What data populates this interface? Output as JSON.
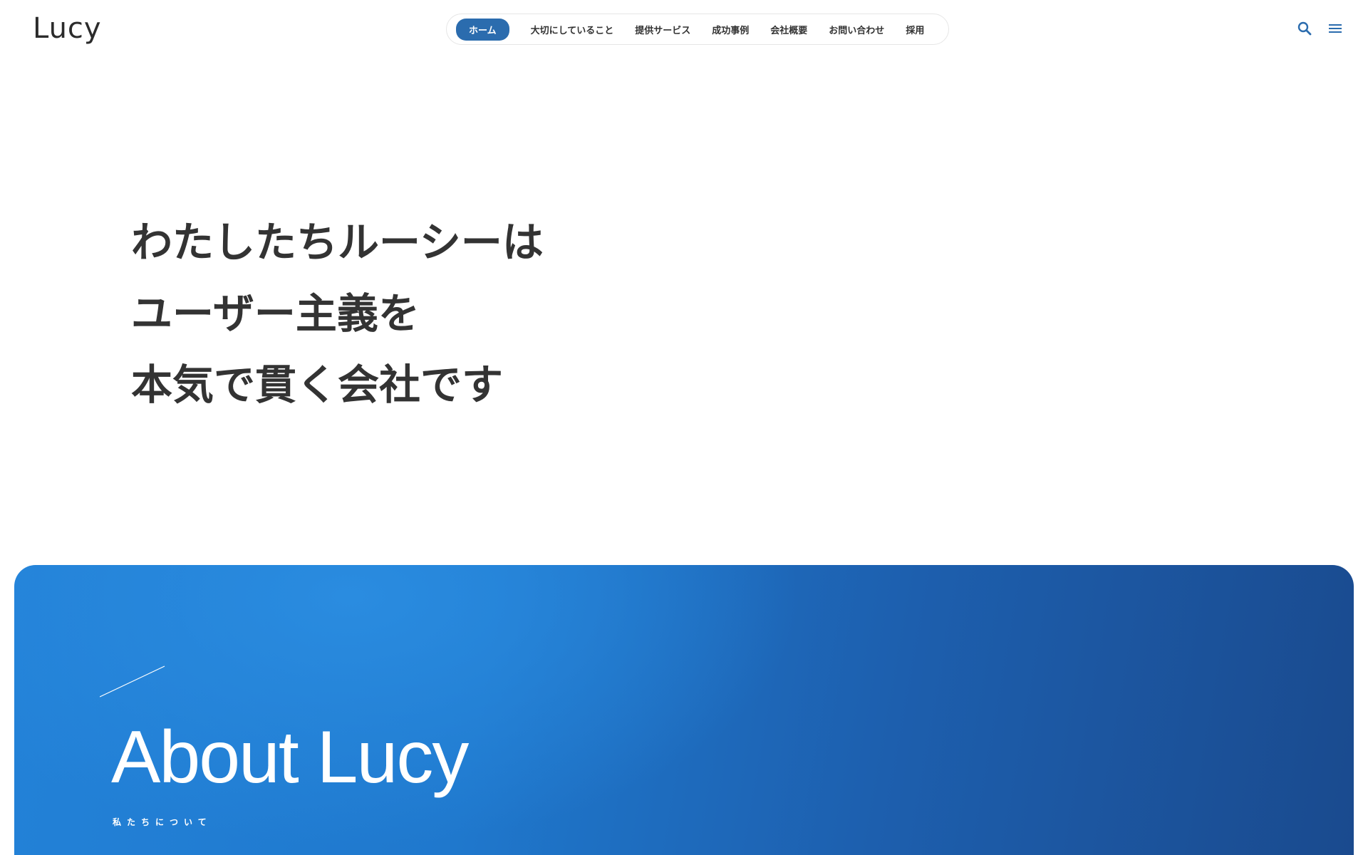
{
  "header": {
    "logo": "Lucy",
    "nav": [
      {
        "label": "ホーム",
        "active": true
      },
      {
        "label": "大切にしていること",
        "active": false
      },
      {
        "label": "提供サービス",
        "active": false
      },
      {
        "label": "成功事例",
        "active": false
      },
      {
        "label": "会社概要",
        "active": false
      },
      {
        "label": "お問い合わせ",
        "active": false
      },
      {
        "label": "採用",
        "active": false
      }
    ],
    "icons": {
      "search": "search-icon",
      "menu": "menu-icon"
    }
  },
  "hero": {
    "lines": [
      "わたしたちルーシーは",
      "ユーザー主義を",
      "本気で貫く会社です"
    ]
  },
  "about": {
    "title": "About Lucy",
    "subtitle": "私たちについて"
  },
  "colors": {
    "accent": "#2b6cae",
    "text": "#333333",
    "section_gradient_start": "#2382d8",
    "section_gradient_end": "#1a4a8e"
  }
}
